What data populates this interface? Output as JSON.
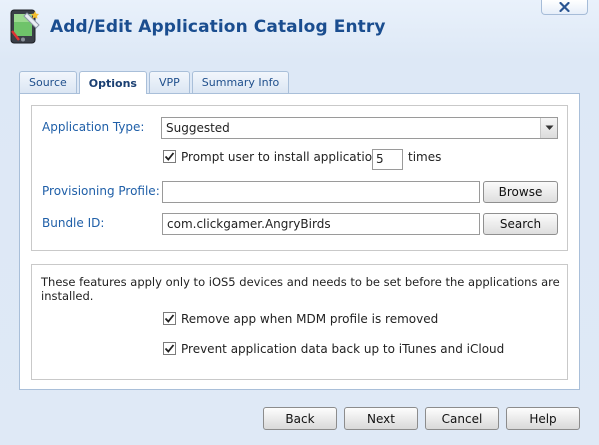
{
  "dialog": {
    "title": "Add/Edit Application Catalog Entry",
    "close_label": "×"
  },
  "tabs": [
    {
      "label": "Source",
      "active": false
    },
    {
      "label": "Options",
      "active": true
    },
    {
      "label": "VPP",
      "active": false
    },
    {
      "label": "Summary Info",
      "active": false
    }
  ],
  "options": {
    "application_type_label": "Application Type:",
    "application_type_value": "Suggested",
    "prompt_label": "Prompt user to install application",
    "prompt_checked": true,
    "prompt_times_value": "5",
    "prompt_times_suffix": "times",
    "provisioning_profile_label": "Provisioning Profile:",
    "provisioning_profile_value": "",
    "browse_label": "Browse",
    "bundle_id_label": "Bundle ID:",
    "bundle_id_value": "com.clickgamer.AngryBirds",
    "search_label": "Search"
  },
  "ios5": {
    "note": "These features apply only to iOS5 devices and needs to be set before the applications are installed.",
    "remove_app_label": "Remove app when MDM profile is removed",
    "remove_app_checked": true,
    "prevent_backup_label": "Prevent application data back up to iTunes and iCloud",
    "prevent_backup_checked": true
  },
  "footer": {
    "back_label": "Back",
    "next_label": "Next",
    "cancel_label": "Cancel",
    "help_label": "Help"
  },
  "colors": {
    "title": "#1a4d8f",
    "label": "#1f5fa8",
    "close_x": "#2a5592"
  }
}
